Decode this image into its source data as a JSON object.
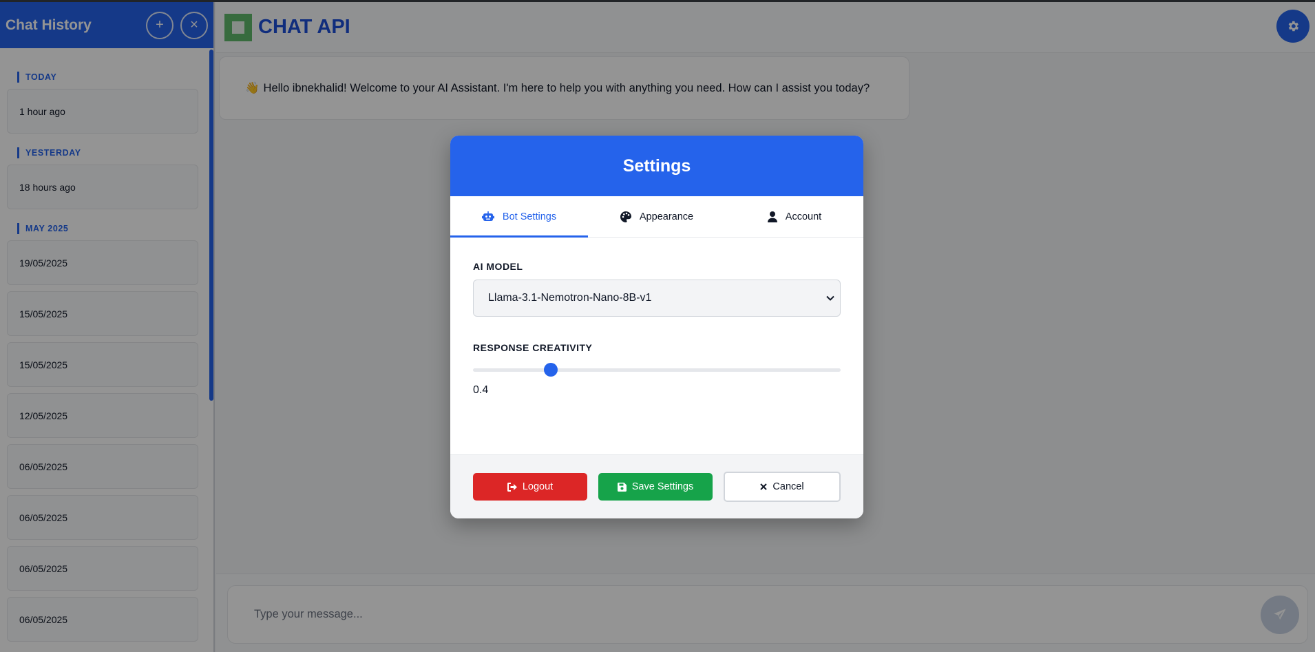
{
  "sidebar": {
    "title": "Chat History",
    "new_chat_label": "+",
    "close_label": "×",
    "groups": [
      {
        "label": "TODAY",
        "items": [
          "1 hour ago"
        ]
      },
      {
        "label": "YESTERDAY",
        "items": [
          "18 hours ago"
        ]
      },
      {
        "label": "MAY 2025",
        "items": [
          "19/05/2025",
          "15/05/2025",
          "15/05/2025",
          "12/05/2025",
          "06/05/2025",
          "06/05/2025",
          "06/05/2025",
          "06/05/2025"
        ]
      }
    ]
  },
  "header": {
    "title": "CHAT API"
  },
  "chat": {
    "welcome_emoji": "👋",
    "welcome_message": "Hello ibnekhalid! Welcome to your AI Assistant. I'm here to help you with anything you need. How can I assist you today?"
  },
  "composer": {
    "placeholder": "Type your message..."
  },
  "modal": {
    "title": "Settings",
    "tabs": [
      {
        "label": "Bot Settings",
        "icon": "robot-icon",
        "active": true
      },
      {
        "label": "Appearance",
        "icon": "palette-icon",
        "active": false
      },
      {
        "label": "Account",
        "icon": "user-icon",
        "active": false
      }
    ],
    "ai_model_label": "AI MODEL",
    "ai_model_value": "Llama-3.1-Nemotron-Nano-8B-v1",
    "creativity_label": "RESPONSE CREATIVITY",
    "creativity_value": "0.4",
    "creativity_fraction": 0.2,
    "buttons": {
      "logout": "Logout",
      "save": "Save Settings",
      "cancel": "Cancel"
    }
  },
  "colors": {
    "primary": "#2563eb",
    "danger": "#dc2626",
    "success": "#16a34a"
  }
}
